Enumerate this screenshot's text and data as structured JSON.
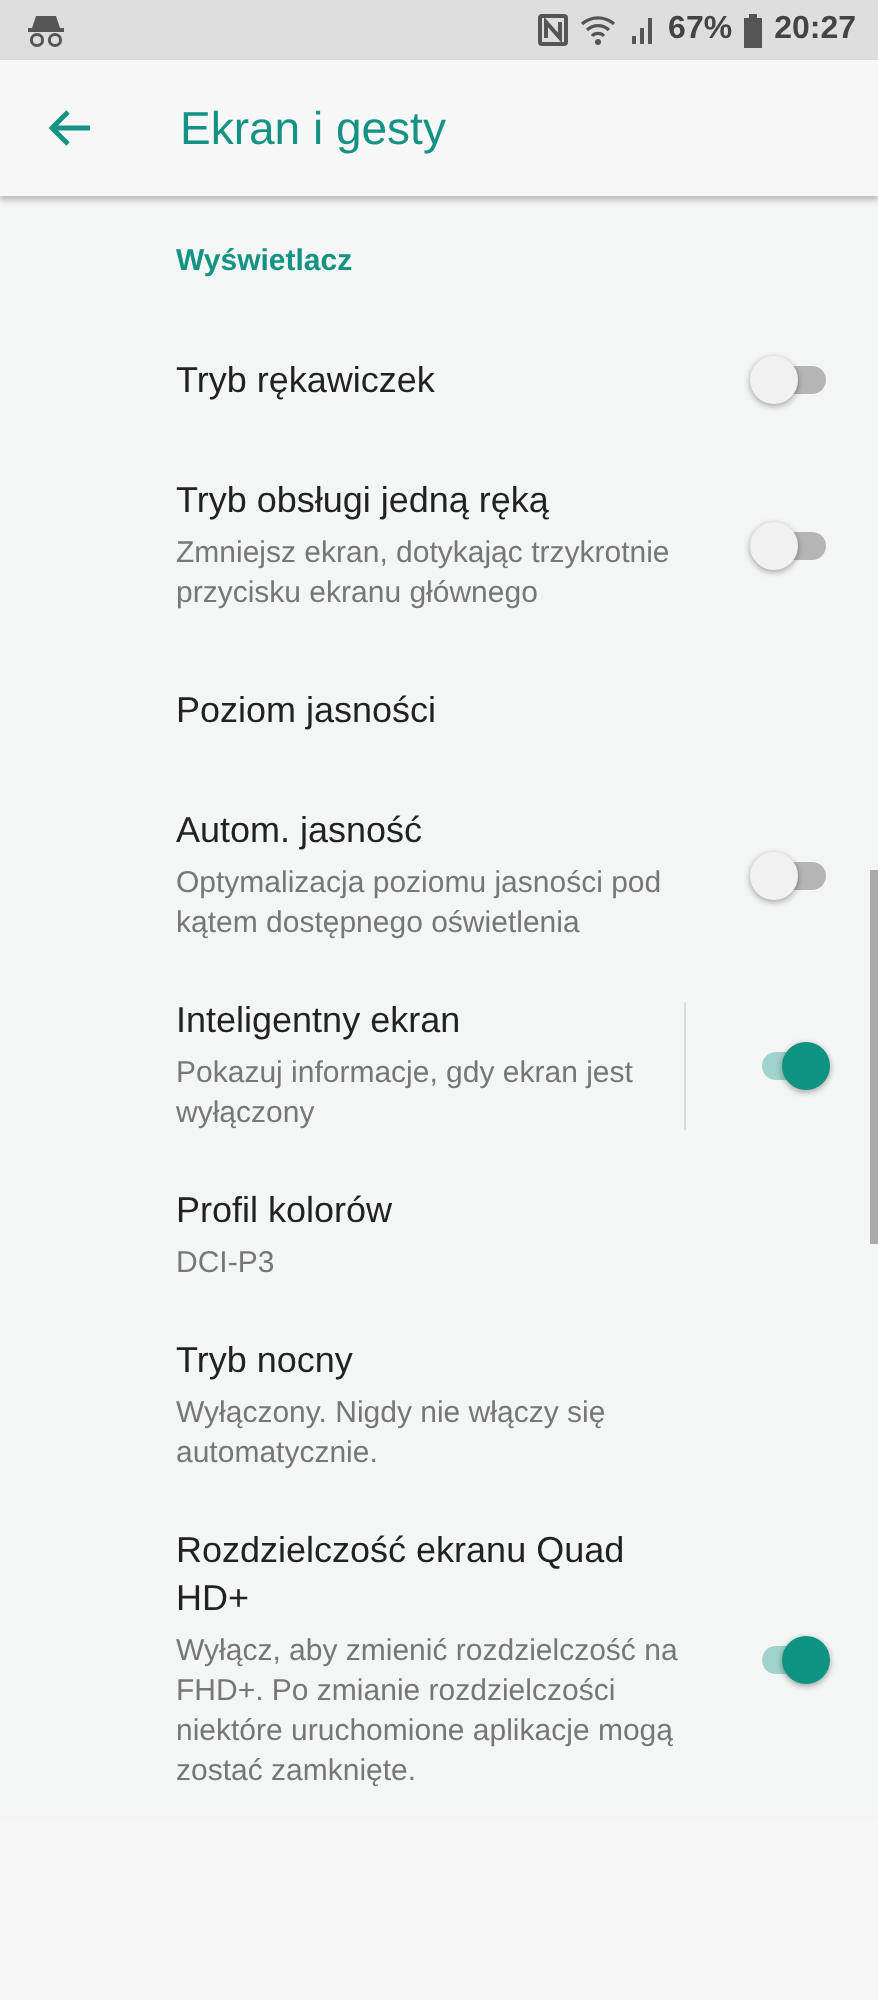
{
  "status_bar": {
    "battery": "67%",
    "time": "20:27"
  },
  "toolbar": {
    "title": "Ekran i gesty"
  },
  "section": {
    "title": "Wyświetlacz"
  },
  "settings": [
    {
      "kind": "switch",
      "title": "Tryb rękawiczek",
      "on": false
    },
    {
      "kind": "switch",
      "title": "Tryb obsługi jedną ręką",
      "summary": "Zmniejsz ekran, dotykając trzykrotnie przycisku ekranu głównego",
      "on": false
    },
    {
      "kind": "plain",
      "title": "Poziom jasności"
    },
    {
      "kind": "switch",
      "title": "Autom. jasność",
      "summary": "Optymalizacja poziomu jasności pod kątem dostępnego oświetlenia",
      "on": false
    },
    {
      "kind": "split_switch",
      "title": "Inteligentny ekran",
      "summary": "Pokazuj informacje, gdy ekran jest wyłączony",
      "on": true
    },
    {
      "kind": "plain",
      "title": "Profil kolorów",
      "summary": "DCI-P3"
    },
    {
      "kind": "plain",
      "title": "Tryb nocny",
      "summary": "Wyłączony. Nigdy nie włączy się automatycznie."
    },
    {
      "kind": "switch",
      "title": "Rozdzielczość ekranu Quad HD+",
      "summary": "Wyłącz, aby zmienić rozdzielczość na FHD+. Po zmianie rozdzielczości niektóre uruchomione aplikacje mogą zostać zamknięte.",
      "on": true
    }
  ]
}
